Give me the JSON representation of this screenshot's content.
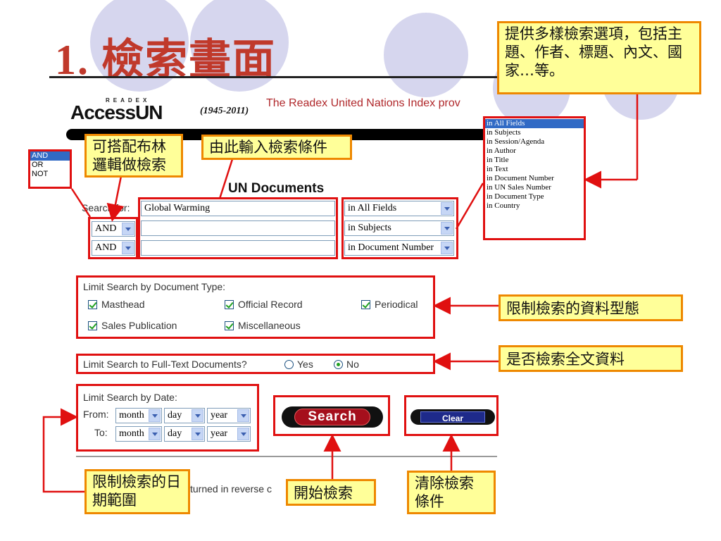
{
  "slide_title": "1. 檢索畫面",
  "accessun": {
    "logo_top": "READEX",
    "logo_main": "AccessUN",
    "years": "(1945-2011)",
    "tagline": "The Readex United Nations Index prov"
  },
  "form": {
    "heading": "UN Documents",
    "search_for_label": "Search for:",
    "rows": [
      {
        "bool": "",
        "term": "Global Warming",
        "field": "in All Fields"
      },
      {
        "bool": "AND",
        "term": "",
        "field": "in Subjects"
      },
      {
        "bool": "AND",
        "term": "",
        "field": "in Document Number"
      }
    ],
    "doc_type": {
      "label": "Limit Search by Document Type:",
      "options": [
        "Masthead",
        "Official Record",
        "Periodical",
        "Sales Publication",
        "Miscellaneous"
      ]
    },
    "fulltext": {
      "label": "Limit Search to Full-Text Documents?",
      "yes": "Yes",
      "no": "No",
      "selected": "No"
    },
    "date": {
      "label": "Limit Search by Date:",
      "from_label": "From:",
      "to_label": "To:",
      "month": "month",
      "day": "day",
      "year": "year"
    },
    "search_button": "Search",
    "clear_button": "Clear",
    "bottom_text": "turned in reverse c"
  },
  "bool_list": [
    "AND",
    "OR",
    "NOT"
  ],
  "field_list": [
    "in All Fields",
    "in Subjects",
    "in Session/Agenda",
    "in Author",
    "in Title",
    "in Text",
    "in Document Number",
    "in UN Sales Number",
    "in Document Type",
    "in Country"
  ],
  "callouts": {
    "options": "提供多樣檢索選項，包括主題、作者、標題、內文、國家…等。",
    "boolean": "可搭配布林邏輯做檢索",
    "input": "由此輸入檢索條件",
    "doctype": "限制檢索的資料型態",
    "fulltext": "是否檢索全文資料",
    "date": "限制檢索的日期範圍",
    "search": "開始檢索",
    "clear": "清除檢索條件"
  },
  "colors": {
    "title": "#c0392b",
    "callout_bg": "#ffff99",
    "callout_border": "#ee8800",
    "annotation_red": "#e01010"
  }
}
